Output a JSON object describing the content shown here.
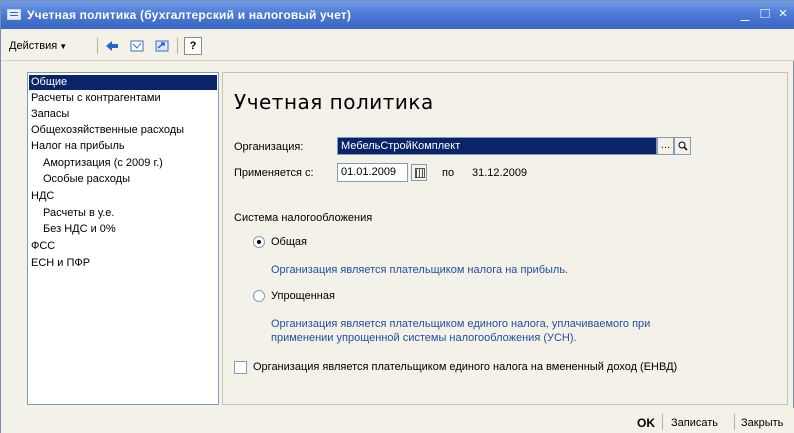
{
  "window": {
    "title": "Учетная политика (бухгалтерский и налоговый учет)",
    "minimize": "_",
    "maximize": "□",
    "close": "×"
  },
  "toolbar": {
    "actions_label": "Действия",
    "help_label": "?"
  },
  "nav": {
    "items": [
      {
        "label": "Общие",
        "selected": true
      },
      {
        "label": "Расчеты с контрагентами"
      },
      {
        "label": "Запасы"
      },
      {
        "label": "Общехозяйственные расходы"
      },
      {
        "label": "Налог на прибыль"
      },
      {
        "label": "Амортизация (с 2009 г.)"
      },
      {
        "label": "Особые расходы"
      },
      {
        "label": "НДС"
      },
      {
        "label": "Расчеты в у.е."
      },
      {
        "label": "Без НДС и 0%"
      },
      {
        "label": "ФСС"
      },
      {
        "label": "ЕСН и ПФР"
      }
    ]
  },
  "main": {
    "title": "Учетная политика",
    "organization_label": "Организация:",
    "organization_value": "МебельСтройКомплект",
    "applies_label": "Применяется с:",
    "applies_date": "01.01.2009",
    "to_label": "по",
    "to_date": "31.12.2009",
    "tax_system_label": "Система налогообложения",
    "option_general": "Общая",
    "option_general_desc": "Организация является плательщиком налога на прибыль.",
    "option_simplified": "Упрощенная",
    "option_simplified_desc_1": "Организация является плательщиком единого налога, уплачиваемого при",
    "option_simplified_desc_2": "применении упрощенной системы налогообложения (УСН).",
    "envd_label": "Организация  является плательщиком единого налога на вмененный доход (ЕНВД)",
    "selected_option": "Общая",
    "envd_checked": false
  },
  "footer": {
    "ok": "OK",
    "save": "Записать",
    "close": "Закрыть"
  },
  "colors": {
    "titlebar": "#4a78d4",
    "selection": "#0a246a",
    "hint_text": "#2050a0",
    "background": "#f4f1e8"
  }
}
